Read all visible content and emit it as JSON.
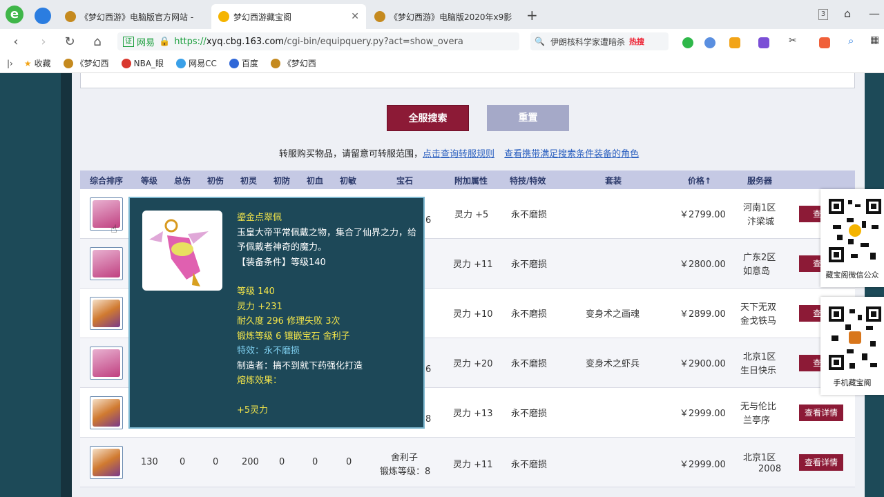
{
  "browser": {
    "tabs": [
      {
        "title": "《梦幻西游》电脑版官方网站 -",
        "active": false
      },
      {
        "title": "梦幻西游藏宝阁",
        "active": true
      },
      {
        "title": "《梦幻西游》电脑版2020年x9影",
        "active": false
      }
    ],
    "new_tab": "+",
    "tab_count": "3",
    "url_badge": "证",
    "url_site": "网易",
    "url_scheme": "https://",
    "url_host": "xyq.cbg.163.com",
    "url_path": "/cgi-bin/equipquery.py?act=show_overa",
    "search_text": "伊朗核科学家遭暗杀",
    "search_hot": "热搜",
    "bookmarks": [
      "收藏",
      "《梦幻西",
      "NBA_眼",
      "网易CC",
      "百度",
      "《梦幻西"
    ]
  },
  "page": {
    "search_button": "全服搜索",
    "reset_button": "重置",
    "notice_text": "转服购买物品，请留意可转服范围，",
    "notice_link1": "点击查询转服规则",
    "notice_link2": "查看携带满足搜索条件装备的角色",
    "columns": [
      "综合排序",
      "等级",
      "总伤",
      "初伤",
      "初灵",
      "初防",
      "初血",
      "初敏",
      "宝石",
      "附加属性",
      "特技/特效",
      "套装",
      "价格↑",
      "服务器"
    ],
    "rows": [
      {
        "gem": "6",
        "attr": "灵力 +5",
        "effect": "永不磨损",
        "suit": "",
        "price": "￥2799.00",
        "server1": "河南1区",
        "server2": "汴梁城",
        "detail": "查看"
      },
      {
        "gem": "",
        "attr": "灵力 +11",
        "effect": "永不磨损",
        "suit": "",
        "price": "￥2800.00",
        "server1": "广东2区",
        "server2": "如意岛",
        "detail": "查看"
      },
      {
        "gem": "",
        "attr": "灵力 +10",
        "effect": "永不磨损",
        "suit": "变身术之画魂",
        "price": "￥2899.00",
        "server1": "天下无双",
        "server2": "金戈铁马",
        "detail": "查看"
      },
      {
        "gem": "6",
        "attr": "灵力 +20",
        "effect": "永不磨损",
        "suit": "变身术之虾兵",
        "price": "￥2900.00",
        "server1": "北京1区",
        "server2": "生日快乐",
        "detail": "查看"
      },
      {
        "gem": "8",
        "attr": "灵力 +13",
        "effect": "永不磨损",
        "suit": "",
        "price": "￥2999.00",
        "server1": "无与伦比",
        "server2": "兰亭序",
        "detail": "查看详情"
      },
      {
        "level": "130",
        "total": "0",
        "c1": "0",
        "c2": "200",
        "c3": "0",
        "c4": "0",
        "c5": "0",
        "gem": "舍利子",
        "gem2": "锻炼等级：8",
        "attr": "灵力 +11",
        "effect": "永不磨损",
        "suit": "",
        "price": "￥2999.00",
        "server1": "北京1区",
        "server2": "2008",
        "detail": "查看详情"
      }
    ]
  },
  "tooltip": {
    "name": "鎏金点翠佩",
    "desc": "玉皇大帝平常佩戴之物，集合了仙界之力，给予佩戴者神奇的魔力。",
    "req": "【装备条件】等级140",
    "level": "等级 140",
    "spirit": "灵力 +231",
    "durability": "耐久度 296 修理失败 3次",
    "forge": "锻炼等级 6 镶嵌宝石 舍利子",
    "effect": "特效：永不磨损",
    "maker": "制造者：搞不到就下药强化打造",
    "melt": "熔炼效果：",
    "melt_val": "+5灵力"
  },
  "qr": {
    "wechat_label": "藏宝阁微信公众",
    "mobile_label": "手机藏宝阁"
  }
}
